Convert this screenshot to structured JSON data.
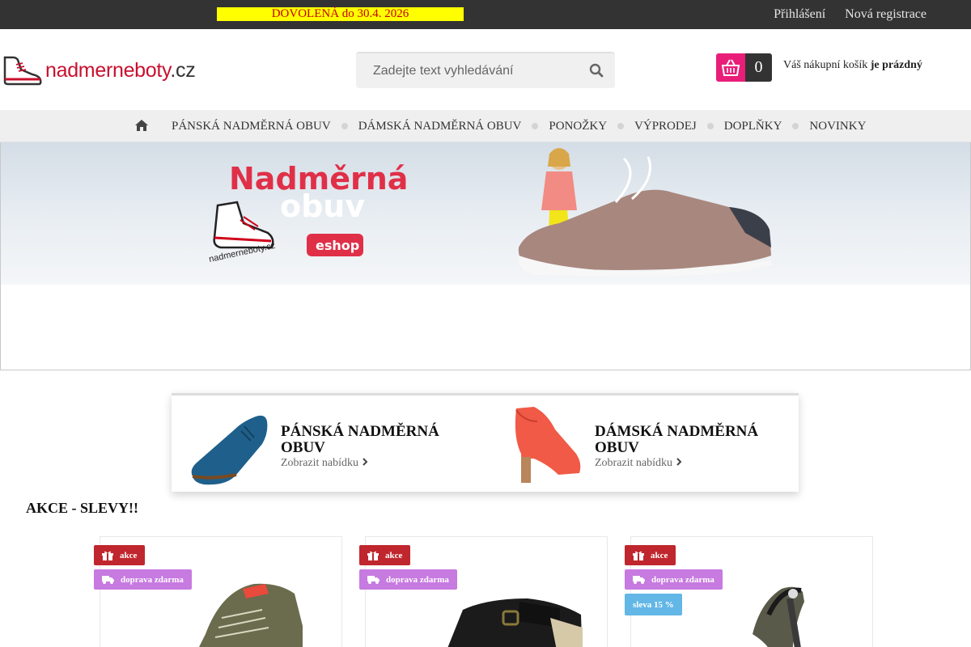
{
  "topbar": {
    "promo": "DOVOLENÁ  do 30.4. 2026",
    "login": "Přihlášení",
    "register": "Nová registrace"
  },
  "header": {
    "logo_name": "nadmerneboty",
    "logo_tld": ".cz",
    "search_placeholder": "Zadejte text vyhledávání",
    "cart_count": "0",
    "cart_text": "Váš nákupní košík",
    "cart_status": "je prázdný"
  },
  "nav": {
    "items": [
      "PÁNSKÁ NADMĚRNÁ OBUV",
      "DÁMSKÁ NADMĚRNÁ OBUV",
      "PONOŽKY",
      "VÝPRODEJ",
      "DOPLŇKY",
      "NOVINKY"
    ]
  },
  "banner": {
    "title_line1": "Nadměrná",
    "title_line2": "obuv",
    "logo_small": "nadmerneboty.cz",
    "eshop": "eshop"
  },
  "categories": [
    {
      "title_line1": "PÁNSKÁ NADMĚRNÁ",
      "title_line2": "OBUV",
      "link": "Zobrazit nabídku"
    },
    {
      "title_line1": "DÁMSKÁ NADMĚRNÁ",
      "title_line2": "OBUV",
      "link": "Zobrazit nabídku"
    }
  ],
  "section_title": "AKCE - SLEVY!!",
  "products": [
    {
      "badges": {
        "akce": "akce",
        "doprava": "doprava zdarma"
      }
    },
    {
      "badges": {
        "akce": "akce",
        "doprava": "doprava zdarma"
      }
    },
    {
      "badges": {
        "akce": "akce",
        "doprava": "doprava zdarma",
        "sleva": "sleva 15 %"
      }
    }
  ],
  "colors": {
    "topbar": "#333333",
    "promo_bg": "#ffff00",
    "brand_red": "#c8102e",
    "cart_pink": "#e91e79",
    "badge_akce": "#c0262d",
    "badge_doprava": "#c77ae0",
    "badge_sleva": "#62b7e6"
  }
}
